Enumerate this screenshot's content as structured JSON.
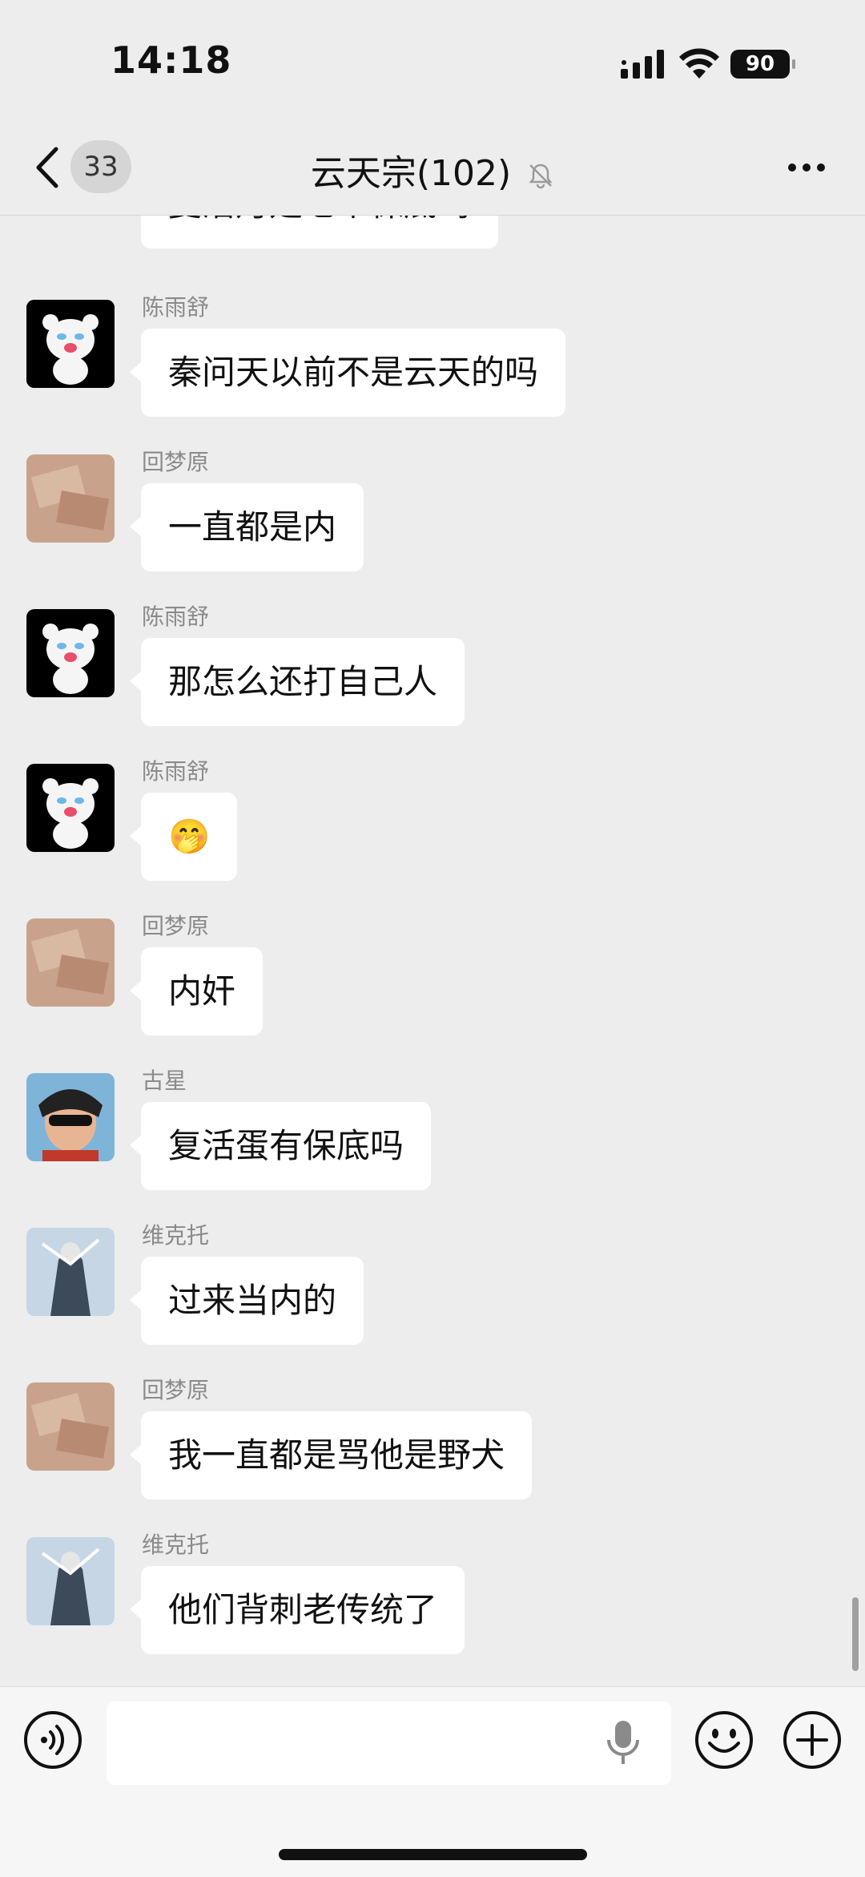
{
  "status_bar": {
    "time": "14:18",
    "battery": "90"
  },
  "nav": {
    "back_count": "33",
    "title": "云天宗(102)"
  },
  "messages": [
    {
      "sender": "",
      "text": "复活丹是七个保底吗"
    },
    {
      "sender": "陈雨舒",
      "text": "秦问天以前不是云天的吗"
    },
    {
      "sender": "回梦原",
      "text": "一直都是内"
    },
    {
      "sender": "陈雨舒",
      "text": "那怎么还打自己人"
    },
    {
      "sender": "陈雨舒",
      "text": "🤭"
    },
    {
      "sender": "回梦原",
      "text": "内奸"
    },
    {
      "sender": "古星",
      "text": "复活蛋有保底吗"
    },
    {
      "sender": "维克托",
      "text": "过来当内的"
    },
    {
      "sender": "回梦原",
      "text": "我一直都是骂他是野犬"
    },
    {
      "sender": "维克托",
      "text": "他们背刺老传统了"
    }
  ],
  "input": {
    "value": "",
    "placeholder": ""
  },
  "icons": {
    "back": "chevron-left-icon",
    "mute": "bell-off-icon",
    "more": "more-horizontal-icon",
    "voice": "voice-icon",
    "mic": "microphone-icon",
    "emoji": "emoji-icon",
    "plus": "plus-icon"
  }
}
